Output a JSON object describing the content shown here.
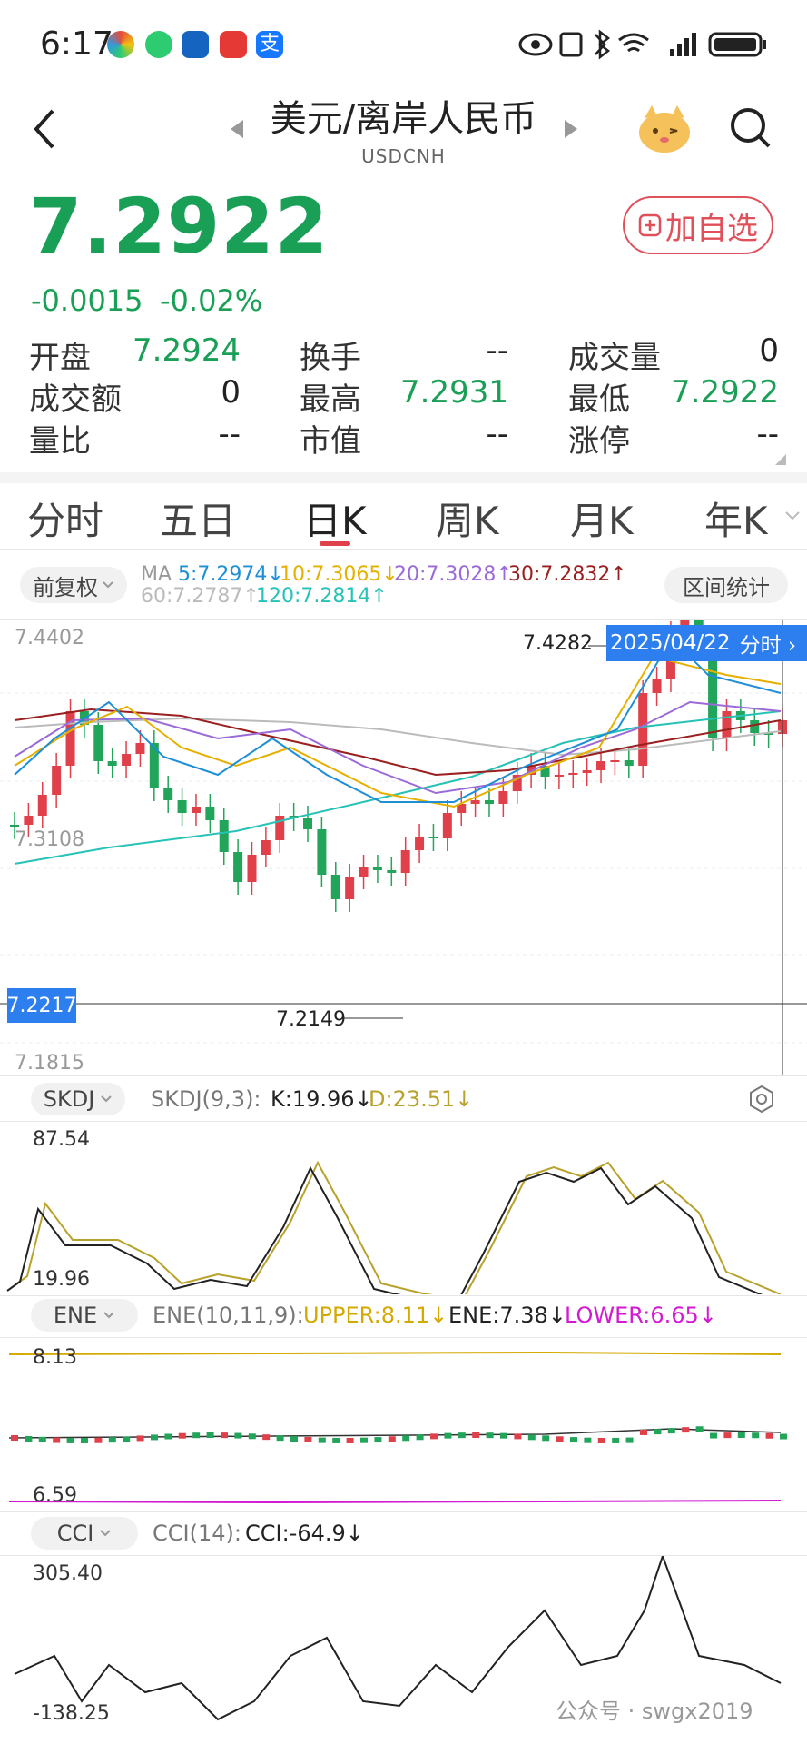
{
  "status_bar": {
    "time": "6:17"
  },
  "header": {
    "title": "美元/离岸人民币",
    "symbol": "USDCNH",
    "back_icon": "chevron-left-icon",
    "search_icon": "search-icon"
  },
  "quote": {
    "price": "7.2922",
    "change": "-0.0015",
    "change_pct": "-0.02%",
    "add_watchlist": "加自选",
    "stats": [
      {
        "label": "开盘",
        "value": "7.2924",
        "green": true
      },
      {
        "label": "换手",
        "value": "--",
        "green": false
      },
      {
        "label": "成交量",
        "value": "0",
        "green": false
      },
      {
        "label": "成交额",
        "value": "0",
        "green": false
      },
      {
        "label": "最高",
        "value": "7.2931",
        "green": true
      },
      {
        "label": "最低",
        "value": "7.2922",
        "green": true
      },
      {
        "label": "量比",
        "value": "--",
        "green": false
      },
      {
        "label": "市值",
        "value": "--",
        "green": false
      },
      {
        "label": "涨停",
        "value": "--",
        "green": false
      }
    ]
  },
  "tabs": [
    "分时",
    "五日",
    "日K",
    "周K",
    "月K",
    "年K"
  ],
  "active_tab": "日K",
  "chart_controls": {
    "adjust": "前复权",
    "range_stats": "区间统计"
  },
  "ma_legend": {
    "prefix": "MA",
    "ma5": "5:7.2974↓",
    "ma10": "10:7.3065↓",
    "ma20": "20:7.3028↑",
    "ma30": "30:7.2832↑",
    "ma60": "60:7.2787↑",
    "ma120": "120:7.2814↑",
    "colors": {
      "ma5": "#1e8fd6",
      "ma10": "#e6b000",
      "ma20": "#9b6ad8",
      "ma30": "#9a1f1f",
      "ma60": "#bbbbbb",
      "ma120": "#27c2b6"
    }
  },
  "kchart_labels": {
    "top": "7.4402",
    "mid": "7.3108",
    "bottom": "7.1815",
    "high_mark": "7.4282",
    "low_mark": "7.2149",
    "crosshair_price": "7.2217",
    "crosshair_date": "2025/04/22",
    "intraday_btn": "分时 ›"
  },
  "skdj": {
    "btn": "SKDJ",
    "name": "SKDJ(9,3):",
    "k": "K:19.96↓",
    "d": "D:23.51↓",
    "top": "87.54",
    "bottom": "19.96"
  },
  "ene": {
    "btn": "ENE",
    "name": "ENE(10,11,9):",
    "upper": "UPPER:8.11↓",
    "ene": "ENE:7.38↓",
    "lower": "LOWER:6.65↓",
    "top": "8.13",
    "bottom": "6.59"
  },
  "cci": {
    "btn": "CCI",
    "name": "CCI(14):",
    "cci": "CCI:-64.9↓",
    "top": "305.40",
    "bottom": "-138.25"
  },
  "footer": {
    "watermark": "公众号 · swgx2019"
  }
}
